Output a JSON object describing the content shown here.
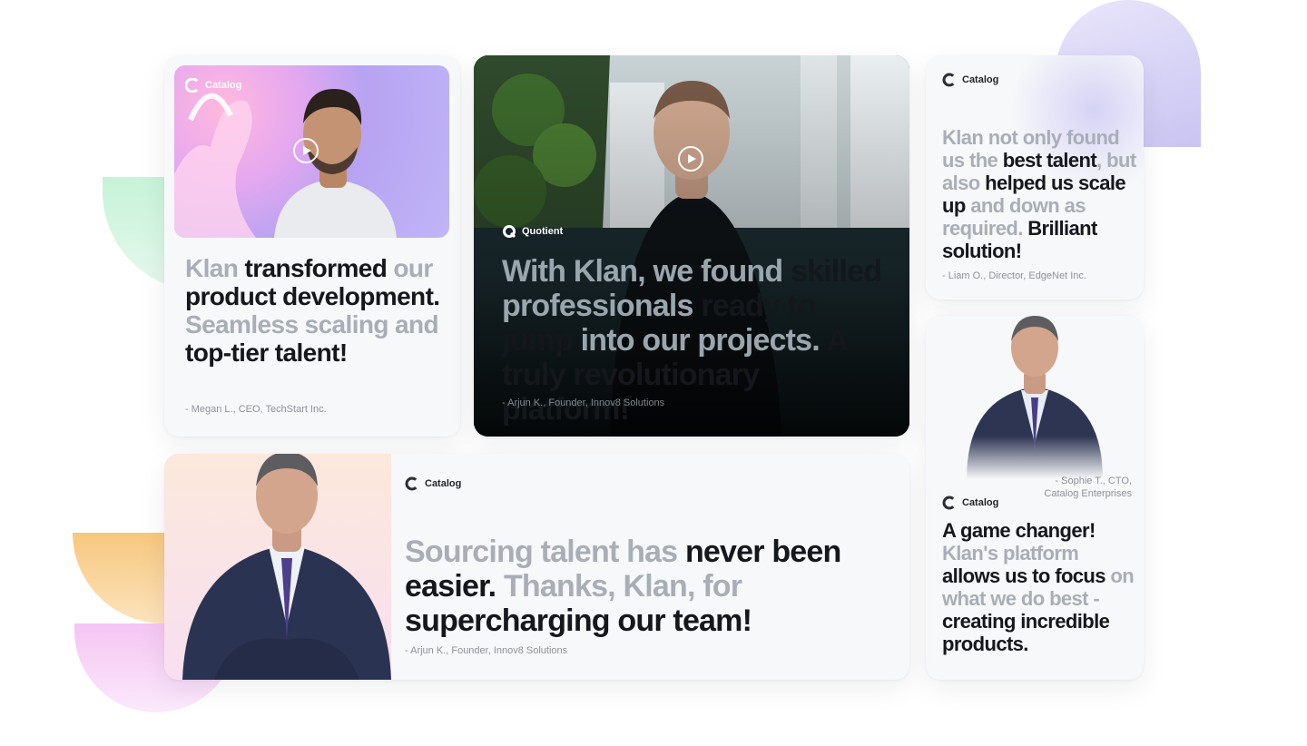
{
  "brands": {
    "catalog": "Catalog",
    "quotient": "Quotient"
  },
  "colors": {
    "muted_text": "#a9aeb6",
    "dark_text": "#14171c",
    "card_bg": "#f7f8fa"
  },
  "cards": [
    {
      "brand": "Catalog",
      "quote": [
        {
          "t": "Klan ",
          "s": "muted"
        },
        {
          "t": "transformed",
          "s": "dark"
        },
        {
          "t": " our ",
          "s": "muted"
        },
        {
          "t": "product development.",
          "s": "dark"
        },
        {
          "t": " Seamless scaling and ",
          "s": "muted"
        },
        {
          "t": "top-tier talent!",
          "s": "dark"
        }
      ],
      "attribution": "- Megan L., CEO, TechStart Inc."
    },
    {
      "brand": "Quotient",
      "quote": [
        {
          "t": "With Klan, we found ",
          "s": "muted"
        },
        {
          "t": "skilled",
          "s": "dark"
        },
        {
          "t": " professionals ",
          "s": "muted"
        },
        {
          "t": "ready to jump",
          "s": "dark"
        },
        {
          "t": " into our projects. ",
          "s": "muted"
        },
        {
          "t": "A truly revolutionary platform!",
          "s": "dark"
        }
      ],
      "attribution": "- Arjun K., Founder, Innov8 Solutions"
    },
    {
      "brand": "Catalog",
      "quote": [
        {
          "t": "Klan not only found us the ",
          "s": "muted"
        },
        {
          "t": "best talent",
          "s": "dark"
        },
        {
          "t": ", but also ",
          "s": "muted"
        },
        {
          "t": "helped us scale up",
          "s": "dark"
        },
        {
          "t": " and down as required. ",
          "s": "muted"
        },
        {
          "t": "Brilliant solution!",
          "s": "dark"
        }
      ],
      "attribution": "- Liam O., Director, EdgeNet Inc."
    },
    {
      "brand": "Catalog",
      "quote": [
        {
          "t": "A game changer!",
          "s": "dark"
        },
        {
          "t": " Klan's platform ",
          "s": "muted"
        },
        {
          "t": "allows us to focus",
          "s": "dark"
        },
        {
          "t": " on what we do best - ",
          "s": "muted"
        },
        {
          "t": "creating incredible products.",
          "s": "dark"
        }
      ],
      "attribution": "- Sophie T., CTO, Catalog Enterprises"
    },
    {
      "brand": "Catalog",
      "quote": [
        {
          "t": "Sourcing talent has ",
          "s": "muted"
        },
        {
          "t": "never been easier.",
          "s": "dark"
        },
        {
          "t": " Thanks, Klan, for ",
          "s": "muted"
        },
        {
          "t": "supercharging our team!",
          "s": "dark"
        }
      ],
      "attribution": "- Arjun K., Founder, Innov8 Solutions"
    }
  ],
  "icons": [
    "catalog-logo-icon",
    "quotient-logo-icon",
    "play-icon"
  ]
}
